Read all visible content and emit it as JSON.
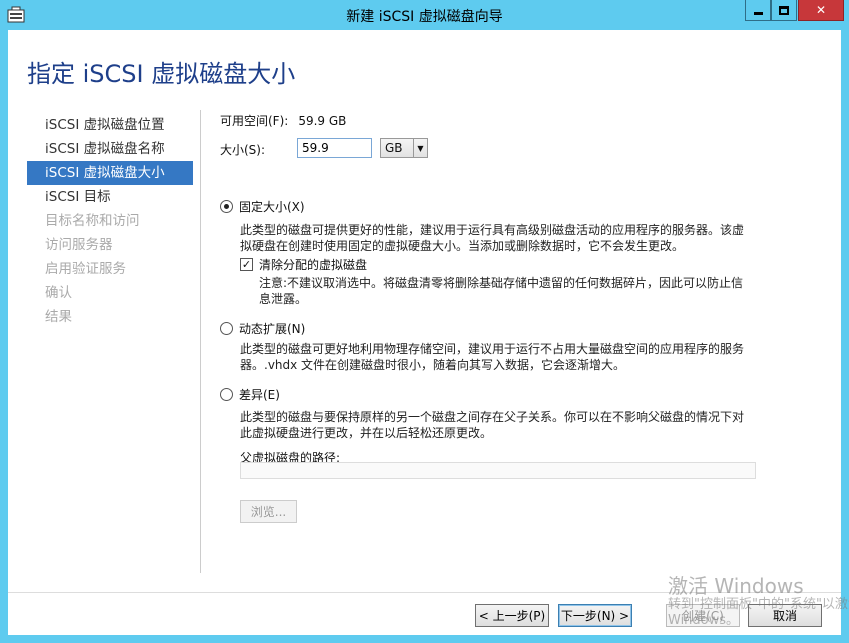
{
  "window": {
    "title": "新建 iSCSI 虚拟磁盘向导",
    "accent": "#5ecbef",
    "close_color": "#c7373a"
  },
  "page": {
    "title": "指定 iSCSI 虚拟磁盘大小"
  },
  "nav": {
    "items": [
      {
        "label": "iSCSI 虚拟磁盘位置",
        "state": "normal"
      },
      {
        "label": "iSCSI 虚拟磁盘名称",
        "state": "normal"
      },
      {
        "label": "iSCSI 虚拟磁盘大小",
        "state": "selected"
      },
      {
        "label": "iSCSI 目标",
        "state": "normal"
      },
      {
        "label": "目标名称和访问",
        "state": "disabled"
      },
      {
        "label": "访问服务器",
        "state": "disabled"
      },
      {
        "label": "启用验证服务",
        "state": "disabled"
      },
      {
        "label": "确认",
        "state": "disabled"
      },
      {
        "label": "结果",
        "state": "disabled"
      }
    ]
  },
  "size": {
    "available_label": "可用空间(F):",
    "available_value": "59.9 GB",
    "size_label": "大小(S):",
    "size_value": "59.9",
    "unit": "GB"
  },
  "options": {
    "fixed": {
      "label": "固定大小(X)",
      "checked": true,
      "desc": "此类型的磁盘可提供更好的性能，建议用于运行具有高级别磁盘活动的应用程序的服务器。该虚拟硬盘在创建时使用固定的虚拟硬盘大小。当添加或删除数据时，它不会发生更改。",
      "clear_label": "清除分配的虚拟磁盘",
      "clear_checked": true,
      "clear_note": "注意:不建议取消选中。将磁盘清零将删除基础存储中遗留的任何数据碎片，因此可以防止信息泄露。"
    },
    "dynamic": {
      "label": "动态扩展(N)",
      "checked": false,
      "desc": "此类型的磁盘可更好地利用物理存储空间，建议用于运行不占用大量磁盘空间的应用程序的服务器。.vhdx 文件在创建磁盘时很小，随着向其写入数据，它会逐渐增大。"
    },
    "diff": {
      "label": "差异(E)",
      "checked": false,
      "desc": "此类型的磁盘与要保持原样的另一个磁盘之间存在父子关系。你可以在不影响父磁盘的情况下对此虚拟硬盘进行更改，并在以后轻松还原更改。",
      "path_label": "父虚拟磁盘的路径:",
      "path_value": "",
      "browse_label": "浏览..."
    }
  },
  "footer": {
    "prev_label": "< 上一步(P)",
    "next_label": "下一步(N) >",
    "create_label": "创建(C)",
    "cancel_label": "取消"
  },
  "watermark": {
    "line1": "激活 Windows",
    "line2": "转到\"控制面板\"中的\"系统\"以激活",
    "line3": "Windows。"
  }
}
